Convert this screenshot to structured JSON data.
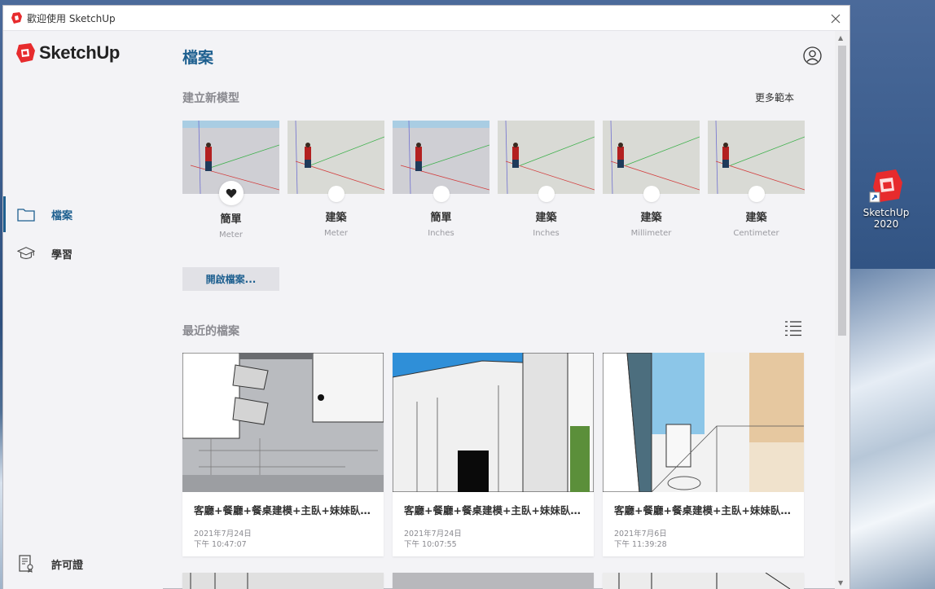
{
  "window": {
    "title": "歡迎使用 SketchUp"
  },
  "brand": {
    "name": "SketchUp",
    "color": "#e72b2d"
  },
  "sidebar": {
    "items": [
      {
        "label": "檔案",
        "icon": "folder-icon",
        "active": true
      },
      {
        "label": "學習",
        "icon": "graduation-cap-icon",
        "active": false
      }
    ],
    "footer": {
      "label": "許可證",
      "icon": "license-icon"
    }
  },
  "main": {
    "page_title": "檔案",
    "new_model": {
      "heading": "建立新模型",
      "more_link": "更多範本",
      "templates": [
        {
          "name": "簡單",
          "unit": "Meter",
          "favorite": true
        },
        {
          "name": "建築",
          "unit": "Meter",
          "favorite": false
        },
        {
          "name": "簡單",
          "unit": "Inches",
          "favorite": false
        },
        {
          "name": "建築",
          "unit": "Inches",
          "favorite": false
        },
        {
          "name": "建築",
          "unit": "Millimeter",
          "favorite": false
        },
        {
          "name": "建築",
          "unit": "Centimeter",
          "favorite": false
        }
      ],
      "open_button": "開啟檔案..."
    },
    "recent": {
      "heading": "最近的檔案",
      "files": [
        {
          "name": "客廳+餐廳+餐桌建模+主臥+妹妹臥室+...",
          "date": "2021年7月24日",
          "time": "下午 10:47:07"
        },
        {
          "name": "客廳+餐廳+餐桌建模+主臥+妹妹臥室+...",
          "date": "2021年7月24日",
          "time": "下午 10:07:55"
        },
        {
          "name": "客廳+餐廳+餐桌建模+主臥+妹妹臥室+...",
          "date": "2021年7月6日",
          "time": "下午 11:39:28"
        }
      ]
    }
  },
  "desktop": {
    "shortcut_label": "SketchUp\n2020"
  },
  "colors": {
    "accent": "#1d5f8f",
    "background": "#f3f3f6"
  }
}
